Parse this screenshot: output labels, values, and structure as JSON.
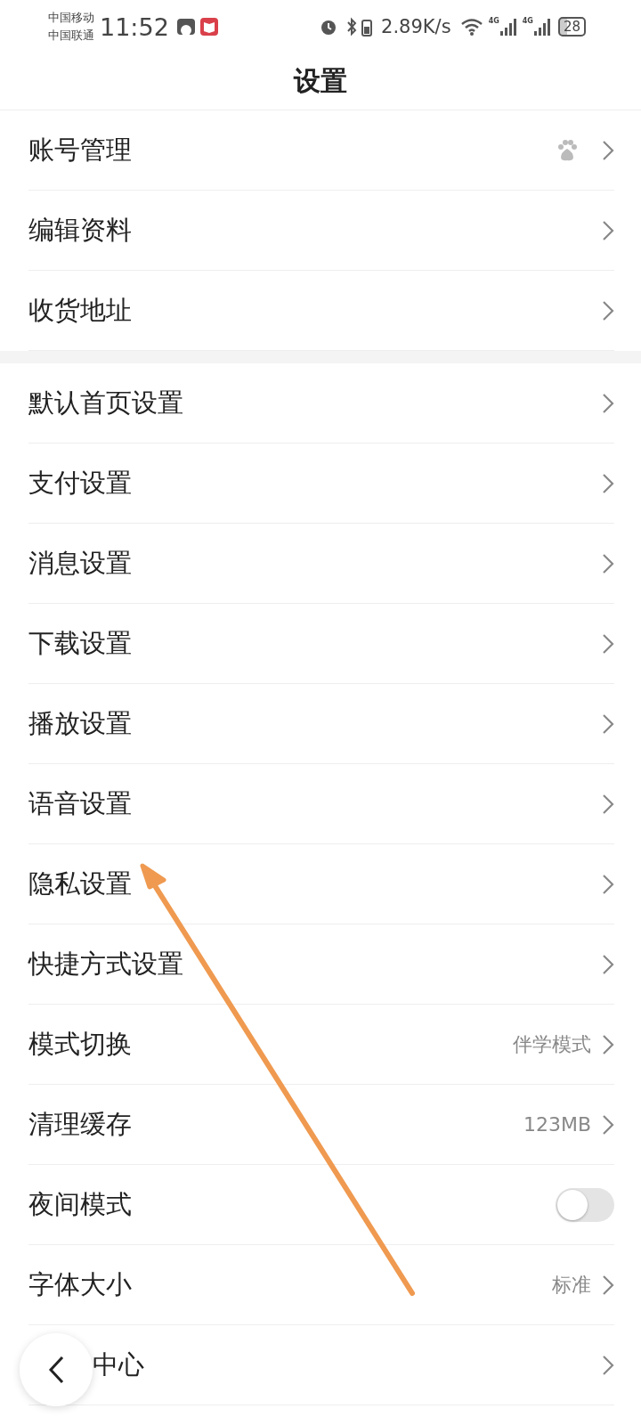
{
  "status_bar": {
    "carriers": [
      "中国移动",
      "中国联通"
    ],
    "time": "11:52",
    "speed": "2.89K/s",
    "network_labels": [
      "4G",
      "4G"
    ],
    "battery": "28"
  },
  "title": "设置",
  "groups": [
    {
      "rows": [
        {
          "label": "账号管理",
          "kind": "account"
        },
        {
          "label": "编辑资料",
          "kind": "link"
        },
        {
          "label": "收货地址",
          "kind": "link"
        }
      ]
    },
    {
      "rows": [
        {
          "label": "默认首页设置",
          "kind": "link"
        },
        {
          "label": "支付设置",
          "kind": "link"
        },
        {
          "label": "消息设置",
          "kind": "link"
        },
        {
          "label": "下载设置",
          "kind": "link"
        },
        {
          "label": "播放设置",
          "kind": "link"
        },
        {
          "label": "语音设置",
          "kind": "link"
        },
        {
          "label": "隐私设置",
          "kind": "link"
        },
        {
          "label": "快捷方式设置",
          "kind": "link"
        },
        {
          "label": "模式切换",
          "kind": "link",
          "value": "伴学模式"
        },
        {
          "label": "清理缓存",
          "kind": "link",
          "value": "123MB"
        },
        {
          "label": "夜间模式",
          "kind": "toggle",
          "on": false
        },
        {
          "label": "字体大小",
          "kind": "link",
          "value": "标准"
        },
        {
          "label": "中心",
          "kind": "covered"
        }
      ]
    }
  ]
}
